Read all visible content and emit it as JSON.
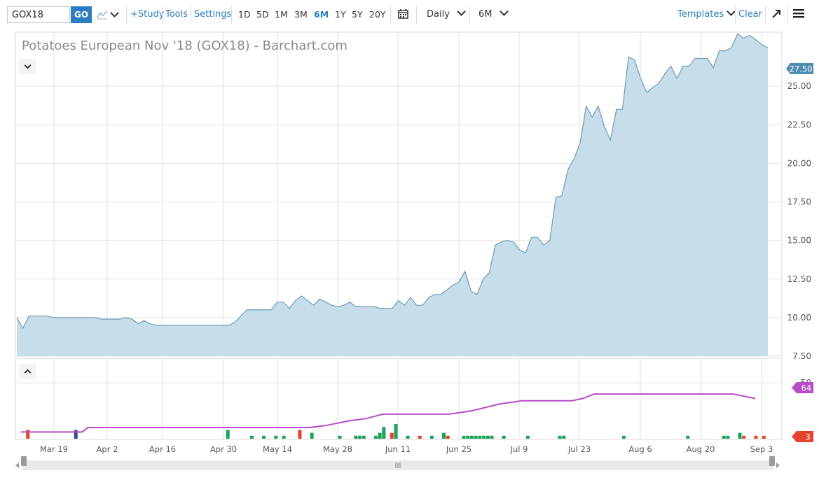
{
  "toolbar": {
    "symbol": "GOX18",
    "go_label": "GO",
    "study_label": "+Study",
    "tools_label": "Tools",
    "settings_label": "Settings",
    "periods": [
      "1D",
      "5D",
      "1M",
      "3M",
      "6M",
      "1Y",
      "5Y",
      "20Y"
    ],
    "active_period": "6M",
    "interval_label": "Daily",
    "range_label": "6M",
    "templates_label": "Templates",
    "clear_label": "Clear"
  },
  "chart_data": [
    {
      "type": "area",
      "title": "Potatoes European Nov '18 (GOX18) - Barchart.com",
      "ylim": [
        7.5,
        28.5
      ],
      "yticks": [
        "7.50",
        "10.00",
        "12.50",
        "15.00",
        "17.50",
        "20.00",
        "22.50",
        "25.00"
      ],
      "last_value_label": "27.50",
      "xtick_labels": [
        "Mar 19",
        "Apr 2",
        "Apr 16",
        "Apr 30",
        "May 14",
        "May 28",
        "Jun 11",
        "Jun 25",
        "Jul 9",
        "Jul 23",
        "Aug 6",
        "Aug 20",
        "Sep 3"
      ],
      "x_day": [
        0,
        1,
        2,
        3,
        4,
        5,
        6,
        7,
        8,
        9,
        10,
        11,
        12,
        13,
        14,
        15,
        16,
        17,
        18,
        19,
        20,
        21,
        22,
        23,
        24,
        25,
        26,
        27,
        28,
        29,
        30,
        31,
        32,
        33,
        34,
        35,
        36,
        37,
        38,
        39,
        40,
        41,
        42,
        43,
        44,
        45,
        46,
        47,
        48,
        49,
        50,
        51,
        52,
        53,
        54,
        55,
        56,
        57,
        58,
        59,
        60,
        61,
        62,
        63,
        64,
        65,
        66,
        67,
        68,
        69,
        70,
        71,
        72,
        73,
        74,
        75,
        76,
        77,
        78,
        79,
        80,
        81,
        82,
        83,
        84,
        85,
        86,
        87,
        88,
        89,
        90,
        91,
        92,
        93,
        94,
        95,
        96,
        97,
        98,
        99,
        100,
        101,
        102,
        103,
        104,
        105,
        106,
        107,
        108,
        109,
        110,
        111,
        112,
        113,
        114,
        115,
        116,
        117,
        118,
        119,
        120,
        121,
        122,
        123,
        124
      ],
      "values": [
        10.0,
        9.3,
        10.1,
        10.1,
        10.1,
        10.1,
        10.0,
        10.0,
        10.0,
        10.0,
        10.0,
        10.0,
        10.0,
        10.0,
        9.9,
        9.9,
        9.9,
        9.9,
        10.0,
        9.9,
        9.6,
        9.8,
        9.6,
        9.5,
        9.5,
        9.5,
        9.5,
        9.5,
        9.5,
        9.5,
        9.5,
        9.5,
        9.5,
        9.5,
        9.5,
        9.5,
        9.7,
        10.1,
        10.5,
        10.5,
        10.5,
        10.5,
        10.5,
        11.0,
        11.0,
        10.6,
        11.1,
        11.4,
        11.1,
        10.8,
        11.2,
        11.0,
        10.8,
        10.7,
        10.8,
        11.0,
        10.7,
        10.7,
        10.7,
        10.7,
        10.6,
        10.6,
        10.6,
        11.1,
        10.8,
        11.3,
        10.8,
        10.8,
        11.3,
        11.5,
        11.5,
        11.8,
        12.1,
        12.3,
        13.0,
        11.7,
        11.5,
        12.5,
        12.9,
        14.7,
        14.9,
        15.0,
        14.9,
        14.4,
        14.2,
        15.2,
        15.2,
        14.7,
        15.0,
        17.8,
        17.9,
        19.6,
        20.3,
        21.3,
        23.7,
        23.0,
        23.7,
        22.4,
        21.5,
        23.5,
        23.5,
        26.9,
        26.7,
        25.5,
        24.6,
        24.9,
        25.2,
        25.8,
        26.3,
        25.5,
        26.3,
        26.3,
        26.8,
        26.8,
        26.8,
        26.2,
        27.3,
        27.3,
        27.5,
        28.4,
        28.1,
        28.3,
        28.0,
        27.7,
        27.5
      ]
    },
    {
      "type": "bar",
      "yticks": [
        "50"
      ],
      "line_last_label": "64",
      "bar_last_label": "3",
      "colors": {
        "line": "#b84bc7",
        "up": "#1aa35a",
        "down": "#e2432f",
        "neutral": "#2b4f8c"
      },
      "line_series": {
        "name": "",
        "x_day": [
          0,
          11,
          12,
          52,
          55,
          59,
          62,
          65,
          77,
          81,
          86,
          90,
          96,
          99,
          101,
          103,
          112,
          123,
          128,
          132
        ],
        "values": [
          6,
          6,
          10,
          10,
          12,
          16,
          18,
          22,
          22,
          25,
          31,
          34,
          34,
          34,
          36,
          40,
          40,
          40,
          40,
          36
        ]
      },
      "bar_series": {
        "x_day": [
          1,
          13,
          51,
          57,
          60,
          63,
          65,
          69,
          72,
          79,
          83,
          84,
          85,
          88,
          89,
          90,
          92,
          93,
          96,
          99,
          102,
          105,
          106,
          110,
          111,
          112,
          113,
          114,
          115,
          116,
          117,
          120,
          126,
          134,
          135,
          150,
          166,
          175,
          176,
          179,
          180,
          183,
          185
        ],
        "values": [
          3,
          3,
          3,
          1,
          1,
          1,
          1,
          3,
          2,
          1,
          1,
          1,
          1,
          1,
          2,
          4,
          2,
          5,
          1,
          1,
          1,
          2,
          1,
          1,
          1,
          1,
          1,
          1,
          1,
          1,
          1,
          1,
          1,
          1,
          1,
          1,
          1,
          1,
          1,
          2,
          1,
          1,
          1
        ],
        "directions": [
          "down",
          "neutral",
          "up",
          "up",
          "up",
          "up",
          "up",
          "down",
          "up",
          "up",
          "up",
          "up",
          "up",
          "up",
          "up",
          "up",
          "down",
          "up",
          "up",
          "down",
          "up",
          "up",
          "down",
          "up",
          "up",
          "up",
          "up",
          "up",
          "up",
          "up",
          "up",
          "up",
          "up",
          "up",
          "up",
          "up",
          "up",
          "up",
          "up",
          "up",
          "down",
          "down",
          "down"
        ]
      }
    }
  ]
}
